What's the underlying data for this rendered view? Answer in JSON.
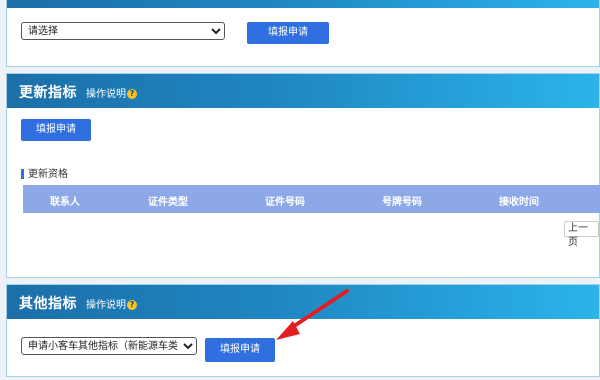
{
  "top_panel": {
    "select_value": "请选择",
    "apply_button": "填报申请"
  },
  "update_panel": {
    "title": "更新指标",
    "help_label": "操作说明",
    "help_icon": "question-icon",
    "apply_button": "填报申请",
    "section_label": "更新资格",
    "columns": [
      "联系人",
      "证件类型",
      "证件号码",
      "号牌号码",
      "接收时间"
    ],
    "pager_prev": "上一页"
  },
  "other_panel": {
    "title": "其他指标",
    "help_label": "操作说明",
    "select_value": "申请小客车其他指标（新能源车类）",
    "apply_button": "填报申请"
  },
  "colors": {
    "header_start": "#1c6fa8",
    "header_end": "#2bb4e8",
    "button": "#2f6fe0",
    "table_header": "#8da8e7",
    "arrow": "#e02020"
  }
}
